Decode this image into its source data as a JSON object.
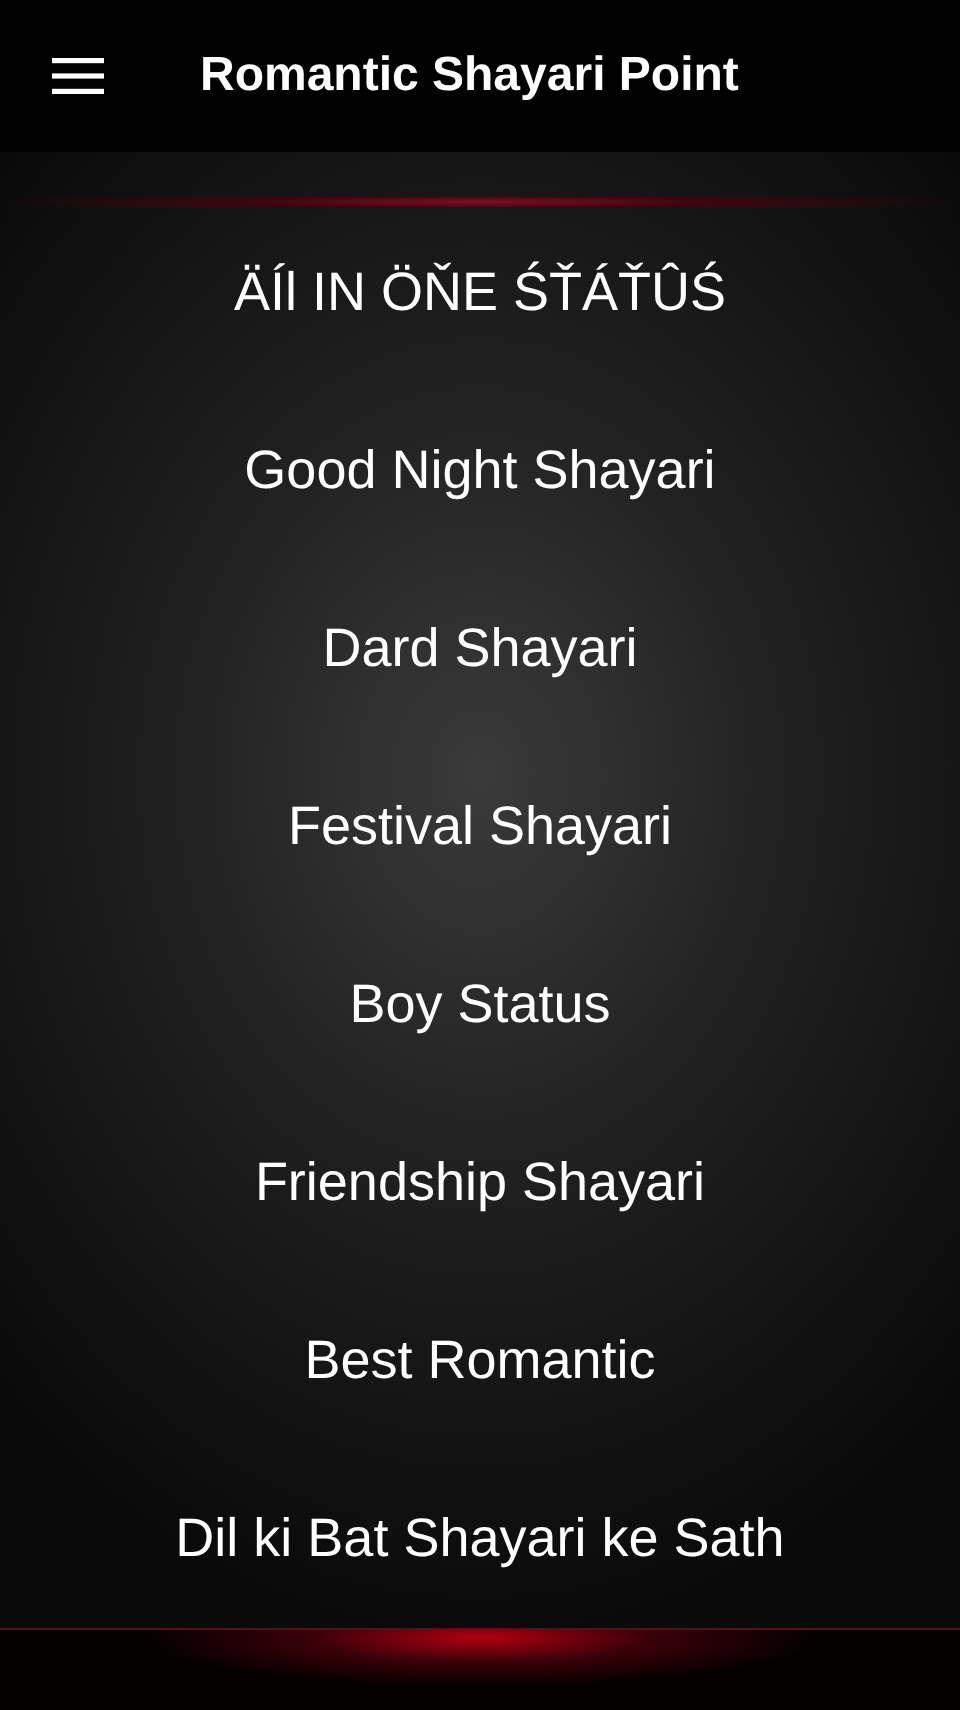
{
  "app_bar": {
    "title": "Romantic Shayari Point"
  },
  "menu": [
    {
      "label": "ÄÍl IN ÖŇE ŚŤÁŤÛŚ"
    },
    {
      "label": "Good Night Shayari"
    },
    {
      "label": "Dard Shayari"
    },
    {
      "label": "Festival Shayari"
    },
    {
      "label": "Boy Status"
    },
    {
      "label": "Friendship Shayari"
    },
    {
      "label": "Best Romantic"
    },
    {
      "label": "Dil ki Bat Shayari ke Sath"
    }
  ]
}
